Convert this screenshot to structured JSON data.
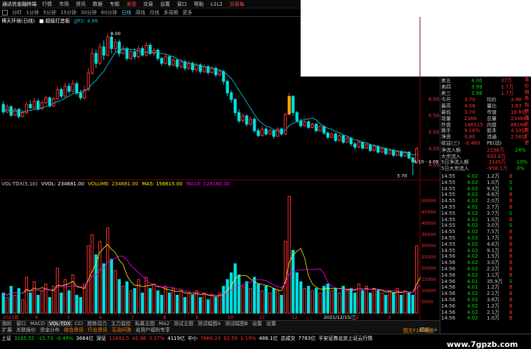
{
  "app": {
    "logo": "通达信金融终端",
    "menu": [
      "行情",
      "市场",
      "资讯",
      "数据",
      "专题",
      "发现",
      "交易",
      "设置",
      "窗口",
      "帮助"
    ],
    "user": "L1L2",
    "trade_label": "交易每"
  },
  "periods": [
    "分时",
    "1分钟",
    "5分钟",
    "15分钟",
    "30分钟",
    "60分钟",
    "日线",
    "周线",
    "月线",
    "多周期",
    "更多"
  ],
  "ma_legend": {
    "title": "博天环境(日线)",
    "tag": "超级打首板",
    "indicator": "JJR5:",
    "indicator_value": "4.86"
  },
  "vol_legend": {
    "name": "VOL-TDX(5,10)",
    "vvol": "VVOL: 234681.00",
    "volume": "VOLUME: 234681.00",
    "ma5": "MA5: 156615.00",
    "ma10": "MA10: 128180.30"
  },
  "colors": {
    "up": "#ff3030",
    "down": "#00e0e0",
    "ma": "#00bcd4",
    "vol_ma5": "#ffff00",
    "vol_ma10": "#ff00ff",
    "accent": "#ffa500"
  },
  "price_axis": {
    "labels": [
      "6.00",
      "5.50",
      "5.00",
      "4.50",
      "4.00"
    ]
  },
  "vol_axis": {
    "labels": [
      "50000",
      "45000",
      "40000",
      "35000",
      "30000",
      "25000",
      "20000",
      "15000",
      "10000",
      "5000"
    ]
  },
  "annotations": {
    "high": "8.00",
    "low": "3.70",
    "range": "4.10 - 4.09"
  },
  "x_axis": {
    "labels": [
      "2021年",
      "4",
      "5",
      "6",
      "7",
      "8",
      "9",
      "10",
      "11",
      "12",
      "2021/12/15/三",
      "2",
      "3"
    ]
  },
  "chart_data": {
    "type": "candlestick",
    "price_range": [
      3.6,
      8.3
    ],
    "volume_range": [
      0,
      55000
    ],
    "candles": [
      [
        5.85,
        5.62,
        5.95,
        5.55
      ],
      [
        5.62,
        5.78,
        5.86,
        5.58
      ],
      [
        5.78,
        5.52,
        5.82,
        5.47
      ],
      [
        5.52,
        5.7,
        5.75,
        5.5
      ],
      [
        5.7,
        5.48,
        5.74,
        5.42
      ],
      [
        5.48,
        5.6,
        5.68,
        5.45
      ],
      [
        5.6,
        5.85,
        5.92,
        5.55
      ],
      [
        5.85,
        5.75,
        5.98,
        5.7
      ],
      [
        5.75,
        5.95,
        6.05,
        5.7
      ],
      [
        5.95,
        5.72,
        6.02,
        5.66
      ],
      [
        5.72,
        5.9,
        5.96,
        5.68
      ],
      [
        5.9,
        6.05,
        6.12,
        5.84
      ],
      [
        6.05,
        5.8,
        6.1,
        5.76
      ],
      [
        5.8,
        6.02,
        6.08,
        5.78
      ],
      [
        6.02,
        6.3,
        6.4,
        5.98
      ],
      [
        6.3,
        6.1,
        6.36,
        6.04
      ],
      [
        6.1,
        6.4,
        6.52,
        6.06
      ],
      [
        6.4,
        6.25,
        6.5,
        6.18
      ],
      [
        6.25,
        6.48,
        6.6,
        6.2
      ],
      [
        6.48,
        6.2,
        6.55,
        6.15
      ],
      [
        6.2,
        6.05,
        6.3,
        5.98
      ],
      [
        6.05,
        6.3,
        6.42,
        6.0
      ],
      [
        6.3,
        6.8,
        6.95,
        6.25
      ],
      [
        6.8,
        7.4,
        7.55,
        6.75
      ],
      [
        7.4,
        7.1,
        7.52,
        6.95
      ],
      [
        7.1,
        7.6,
        7.7,
        7.05
      ],
      [
        7.6,
        7.35,
        7.8,
        7.2
      ],
      [
        7.35,
        7.9,
        8.0,
        7.3
      ],
      [
        7.9,
        7.55,
        7.95,
        7.4
      ],
      [
        7.55,
        7.75,
        7.85,
        7.45
      ],
      [
        7.75,
        7.4,
        7.82,
        7.3
      ],
      [
        7.4,
        7.55,
        7.65,
        7.35
      ],
      [
        7.55,
        7.25,
        7.6,
        7.18
      ],
      [
        7.25,
        7.45,
        7.52,
        7.2
      ],
      [
        7.45,
        7.3,
        7.55,
        7.22
      ],
      [
        7.3,
        7.55,
        7.65,
        7.25
      ],
      [
        7.55,
        7.35,
        7.62,
        7.3
      ],
      [
        7.35,
        7.65,
        7.75,
        7.3
      ],
      [
        7.65,
        7.4,
        7.72,
        7.35
      ],
      [
        7.4,
        7.5,
        7.58,
        7.32
      ],
      [
        7.5,
        7.25,
        7.55,
        7.18
      ],
      [
        7.25,
        7.1,
        7.3,
        7.02
      ],
      [
        7.1,
        7.3,
        7.38,
        7.05
      ],
      [
        7.3,
        7.05,
        7.35,
        6.98
      ],
      [
        7.05,
        7.2,
        7.28,
        7.0
      ],
      [
        7.2,
        7.0,
        7.25,
        6.92
      ],
      [
        7.0,
        7.15,
        7.22,
        6.95
      ],
      [
        7.15,
        6.95,
        7.2,
        6.88
      ],
      [
        6.95,
        7.1,
        7.18,
        6.9
      ],
      [
        7.1,
        6.9,
        7.15,
        6.82
      ],
      [
        6.9,
        7.05,
        7.12,
        6.85
      ],
      [
        7.05,
        6.85,
        7.1,
        6.78
      ],
      [
        6.85,
        7.0,
        7.08,
        6.8
      ],
      [
        7.0,
        6.82,
        7.05,
        6.75
      ],
      [
        6.82,
        6.95,
        7.02,
        6.78
      ],
      [
        6.95,
        6.75,
        7.0,
        6.68
      ],
      [
        6.75,
        6.85,
        6.92,
        6.7
      ],
      [
        6.85,
        6.55,
        6.9,
        6.45
      ],
      [
        6.55,
        6.2,
        6.6,
        6.1
      ],
      [
        6.2,
        6.0,
        6.28,
        5.9
      ],
      [
        6.0,
        5.6,
        6.05,
        5.5
      ],
      [
        5.6,
        5.35,
        5.7,
        5.28
      ],
      [
        5.35,
        5.5,
        5.58,
        5.3
      ],
      [
        5.5,
        5.25,
        5.55,
        5.18
      ],
      [
        5.25,
        5.4,
        5.48,
        5.2
      ],
      [
        5.4,
        5.05,
        5.45,
        4.98
      ],
      [
        5.05,
        4.9,
        5.12,
        4.85
      ],
      [
        4.9,
        5.1,
        5.18,
        4.88
      ],
      [
        5.1,
        4.95,
        5.15,
        4.9
      ],
      [
        4.95,
        5.05,
        5.1,
        4.92
      ],
      [
        5.05,
        4.88,
        5.08,
        4.8
      ],
      [
        4.88,
        5.1,
        5.16,
        4.86
      ],
      [
        5.1,
        4.95,
        5.15,
        4.9
      ],
      [
        4.95,
        5.55,
        5.6,
        4.92
      ],
      [
        5.55,
        6.1,
        6.2,
        5.5
      ],
      [
        6.1,
        5.6,
        6.12,
        5.5
      ],
      [
        5.6,
        5.35,
        5.65,
        5.3
      ],
      [
        5.35,
        5.2,
        5.42,
        5.15
      ],
      [
        5.2,
        5.32,
        5.38,
        5.18
      ],
      [
        5.32,
        5.15,
        5.36,
        5.1
      ],
      [
        5.15,
        5.25,
        5.3,
        5.12
      ],
      [
        5.25,
        5.05,
        5.28,
        5.0
      ],
      [
        5.05,
        5.18,
        5.22,
        5.02
      ],
      [
        5.18,
        4.98,
        5.2,
        4.92
      ],
      [
        4.98,
        4.85,
        5.02,
        4.8
      ],
      [
        4.85,
        4.95,
        5.0,
        4.82
      ],
      [
        4.95,
        4.75,
        4.98,
        4.7
      ],
      [
        4.75,
        4.9,
        4.95,
        4.72
      ],
      [
        4.9,
        4.7,
        4.92,
        4.65
      ],
      [
        4.7,
        4.82,
        4.88,
        4.68
      ],
      [
        4.82,
        4.65,
        4.86,
        4.58
      ],
      [
        4.65,
        4.55,
        4.7,
        4.48
      ],
      [
        4.55,
        4.7,
        4.75,
        4.52
      ],
      [
        4.7,
        4.52,
        4.72,
        4.48
      ],
      [
        4.52,
        4.62,
        4.68,
        4.5
      ],
      [
        4.62,
        4.45,
        4.65,
        4.4
      ],
      [
        4.45,
        4.58,
        4.62,
        4.42
      ],
      [
        4.58,
        4.4,
        4.6,
        4.35
      ],
      [
        4.4,
        4.5,
        4.55,
        4.38
      ],
      [
        4.5,
        4.35,
        4.52,
        4.3
      ],
      [
        4.35,
        4.45,
        4.48,
        4.32
      ],
      [
        4.45,
        4.3,
        4.48,
        4.25
      ],
      [
        4.3,
        4.42,
        4.46,
        4.28
      ],
      [
        4.42,
        4.28,
        4.45,
        4.22
      ],
      [
        4.28,
        4.4,
        4.44,
        4.25
      ],
      [
        4.4,
        4.22,
        4.42,
        4.18
      ],
      [
        4.22,
        4.1,
        4.25,
        3.7
      ],
      [
        4.1,
        4.5,
        4.55,
        4.05
      ]
    ],
    "volumes": [
      9000,
      7000,
      12000,
      8000,
      11000,
      6000,
      16000,
      9000,
      14000,
      8000,
      10000,
      13000,
      7000,
      12000,
      20000,
      9000,
      15000,
      10000,
      17000,
      8000,
      7000,
      13000,
      30000,
      35000,
      26000,
      32000,
      22000,
      38000,
      24000,
      19000,
      15000,
      12000,
      14000,
      10000,
      11000,
      15000,
      9000,
      16000,
      11000,
      13000,
      10000,
      8000,
      12000,
      9000,
      11000,
      8000,
      10000,
      7000,
      9000,
      8000,
      10000,
      7000,
      9000,
      6000,
      8000,
      7000,
      9000,
      12000,
      15000,
      18000,
      22000,
      17000,
      12000,
      14000,
      11000,
      16000,
      13000,
      10000,
      12000,
      9000,
      11000,
      10000,
      8000,
      32000,
      52000,
      28000,
      18000,
      14000,
      11000,
      12000,
      10000,
      11000,
      9000,
      12000,
      13000,
      10000,
      11000,
      9000,
      12000,
      10000,
      11000,
      9000,
      13000,
      10000,
      12000,
      9000,
      11000,
      10000,
      9000,
      8000,
      10000,
      9000,
      11000,
      8000,
      10000,
      9000,
      8000,
      30000,
      23000
    ],
    "ma_line": "MA",
    "vol_ma5": "MA5",
    "vol_ma10": "MA10"
  },
  "panel": {
    "asks": [
      [
        "卖五",
        "4.00",
        "37万"
      ],
      [
        "卖四",
        "3.99",
        "1.7万"
      ],
      [
        "卖三",
        "3.98",
        "1.7万"
      ]
    ],
    "stats": [
      [
        "今开",
        "3.70",
        "均价",
        "3.86"
      ],
      [
        "最高",
        "4.08",
        "量比",
        "1.83"
      ],
      [
        "最低",
        "3.70",
        "市值",
        "16.8亿"
      ],
      [
        "现量",
        "2366",
        "总量",
        "234681"
      ],
      [
        "外盘",
        "146515",
        "内盘",
        "88166"
      ],
      [
        "换手",
        "9.16%",
        "股本",
        "4.10亿"
      ],
      [
        "净资",
        "0.80",
        "流通",
        "2.56亿"
      ],
      [
        "收益(三)",
        "-0.460",
        "PE(动)",
        ""
      ]
    ],
    "flows": [
      [
        "净流入额",
        "2198万",
        "24%"
      ],
      [
        "大宗流入",
        "450.8万",
        ""
      ],
      [
        "5日净流入额",
        "-3149万",
        "-10%"
      ],
      [
        "5日大宗流入",
        "-958.1万",
        "-3%"
      ]
    ],
    "ticks": [
      [
        "14:55",
        "4.02",
        "1.2万",
        "B"
      ],
      [
        "14:55",
        "4.02",
        "1.0万",
        "S"
      ],
      [
        "14:55",
        "4.02",
        "9.3万",
        "S"
      ],
      [
        "14:55",
        "4.02",
        "4.6万",
        "B"
      ],
      [
        "14:55",
        "4.02",
        "2.0万",
        "B"
      ],
      [
        "14:55",
        "4.02",
        "2.7万",
        "B"
      ],
      [
        "14:55",
        "4.02",
        "3.7万",
        "S"
      ],
      [
        "14:55",
        "4.02",
        "1.0万",
        "B"
      ],
      [
        "14:55",
        "4.02",
        "3.0万",
        "S"
      ],
      [
        "14:55",
        "4.02",
        "7.5万",
        "B"
      ],
      [
        "14:55",
        "4.02",
        "1.7万",
        "B"
      ],
      [
        "14:55",
        "4.02",
        "4.6万",
        "B"
      ],
      [
        "14:55",
        "4.02",
        "9.1万",
        "B"
      ],
      [
        "14:56",
        "4.02",
        "1.5万",
        "B"
      ],
      [
        "14:56",
        "4.02",
        "3.0万",
        "B"
      ],
      [
        "14:56",
        "4.02",
        "2.2万",
        "B"
      ],
      [
        "14:56",
        "4.02",
        "1.1万",
        "B"
      ],
      [
        "14:56",
        "4.01",
        "35.9万",
        "S"
      ],
      [
        "14:56",
        "4.01",
        "1.2万",
        "B"
      ],
      [
        "14:56",
        "4.02",
        "2.1万",
        "B"
      ],
      [
        "14:56",
        "4.02",
        "3.8万",
        "B"
      ],
      [
        "14:56",
        "4.02",
        "1.2万",
        "B"
      ],
      [
        "14:56",
        "4.02",
        "2.1万",
        "B"
      ],
      [
        "14:56",
        "4.02",
        "1.0万",
        "B"
      ]
    ],
    "side_tabs": [
      "笔",
      "价",
      "细",
      "势",
      "指",
      "联",
      "值",
      "主",
      "筹",
      "扩",
      "更"
    ]
  },
  "tabs": [
    "指标",
    "窗口",
    "MACD",
    "VOL-TDX",
    "CCI",
    "趋势动力",
    "主力监控",
    "私募主图",
    "MA2",
    "测试主图",
    "测试幅图A",
    "测试幅图B",
    "设置",
    "设置"
  ],
  "tabs2": [
    "扩展",
    "关联报价",
    "资金分布",
    "综合资讯",
    "行业资讯",
    "互动问答",
    "省用户福利专享"
  ],
  "tabs2_right": [
    "模板",
    "+"
  ],
  "status": {
    "sh_label": "上证",
    "sh_val": "3195.52",
    "sh_chg": "-15.73",
    "sh_pct": "-0.49%",
    "sh_amt": "3664亿",
    "sz_label": "深证",
    "sz_val": "11691.5",
    "sz_chg": "42.98",
    "sz_pct": "0.37%",
    "sz_amt": "4119亿",
    "zx_label": "中小",
    "zx_val": "7866.23",
    "zx_chg": "92.59",
    "zx_pct": "1.19%",
    "zx_amt": "488.1亿",
    "cyb_label": "总成交",
    "cyb_val": "7783亿",
    "news": "平安证券北京上证云行情",
    "hint": "图文F10 明细"
  },
  "watermark": "www.7gpzb.com"
}
